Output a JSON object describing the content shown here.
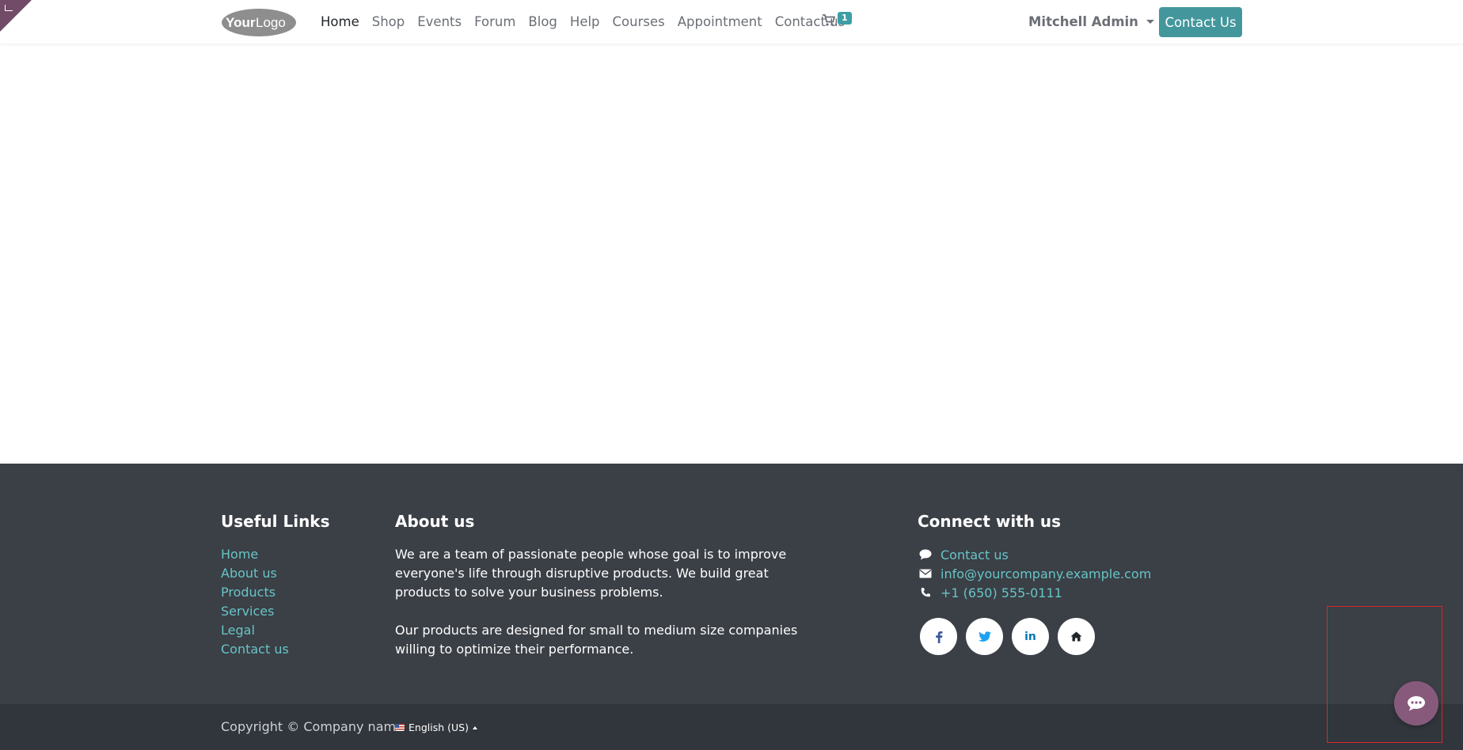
{
  "header": {
    "logo_text_bold": "Your",
    "logo_text_light": "Logo",
    "nav": [
      "Home",
      "Shop",
      "Events",
      "Forum",
      "Blog",
      "Help",
      "Courses",
      "Appointment",
      "Contact us"
    ],
    "active_nav": "Home",
    "cart_count": "1",
    "user_name": "Mitchell Admin",
    "cta_label": "Contact Us"
  },
  "footer": {
    "useful_links_title": "Useful Links",
    "useful_links": [
      "Home",
      "About us",
      "Products",
      "Services",
      "Legal",
      "Contact us"
    ],
    "about_title": "About us",
    "about_p1": "We are a team of passionate people whose goal is to improve everyone's life through disruptive products. We build great products to solve your business problems.",
    "about_p2": "Our products are designed for small to medium size companies willing to optimize their performance.",
    "connect_title": "Connect with us",
    "connect_items": [
      {
        "icon": "comment-icon",
        "label": "Contact us"
      },
      {
        "icon": "envelope-icon",
        "label": "info@yourcompany.example.com"
      },
      {
        "icon": "phone-icon",
        "label": "+1 (650) 555-0111"
      }
    ],
    "social": [
      {
        "icon": "facebook-icon",
        "glyph": "f",
        "color": "#3b5998"
      },
      {
        "icon": "twitter-icon",
        "glyph": "🐦",
        "color": "#1da1f2"
      },
      {
        "icon": "linkedin-icon",
        "glyph": "in",
        "color": "#0077b5"
      },
      {
        "icon": "home-icon",
        "glyph": "⌂",
        "color": "#212529"
      }
    ],
    "copyright": "Copyright © Company name",
    "language": "English (US)"
  },
  "colors": {
    "brand_primary": "#714b67",
    "accent": "#43979c",
    "footer_bg": "#3b3f46",
    "footer_bottom_bg": "#31353c",
    "link": "#66c5c6",
    "chat_button": "#875a7b",
    "highlight_box": "#d9262b"
  }
}
